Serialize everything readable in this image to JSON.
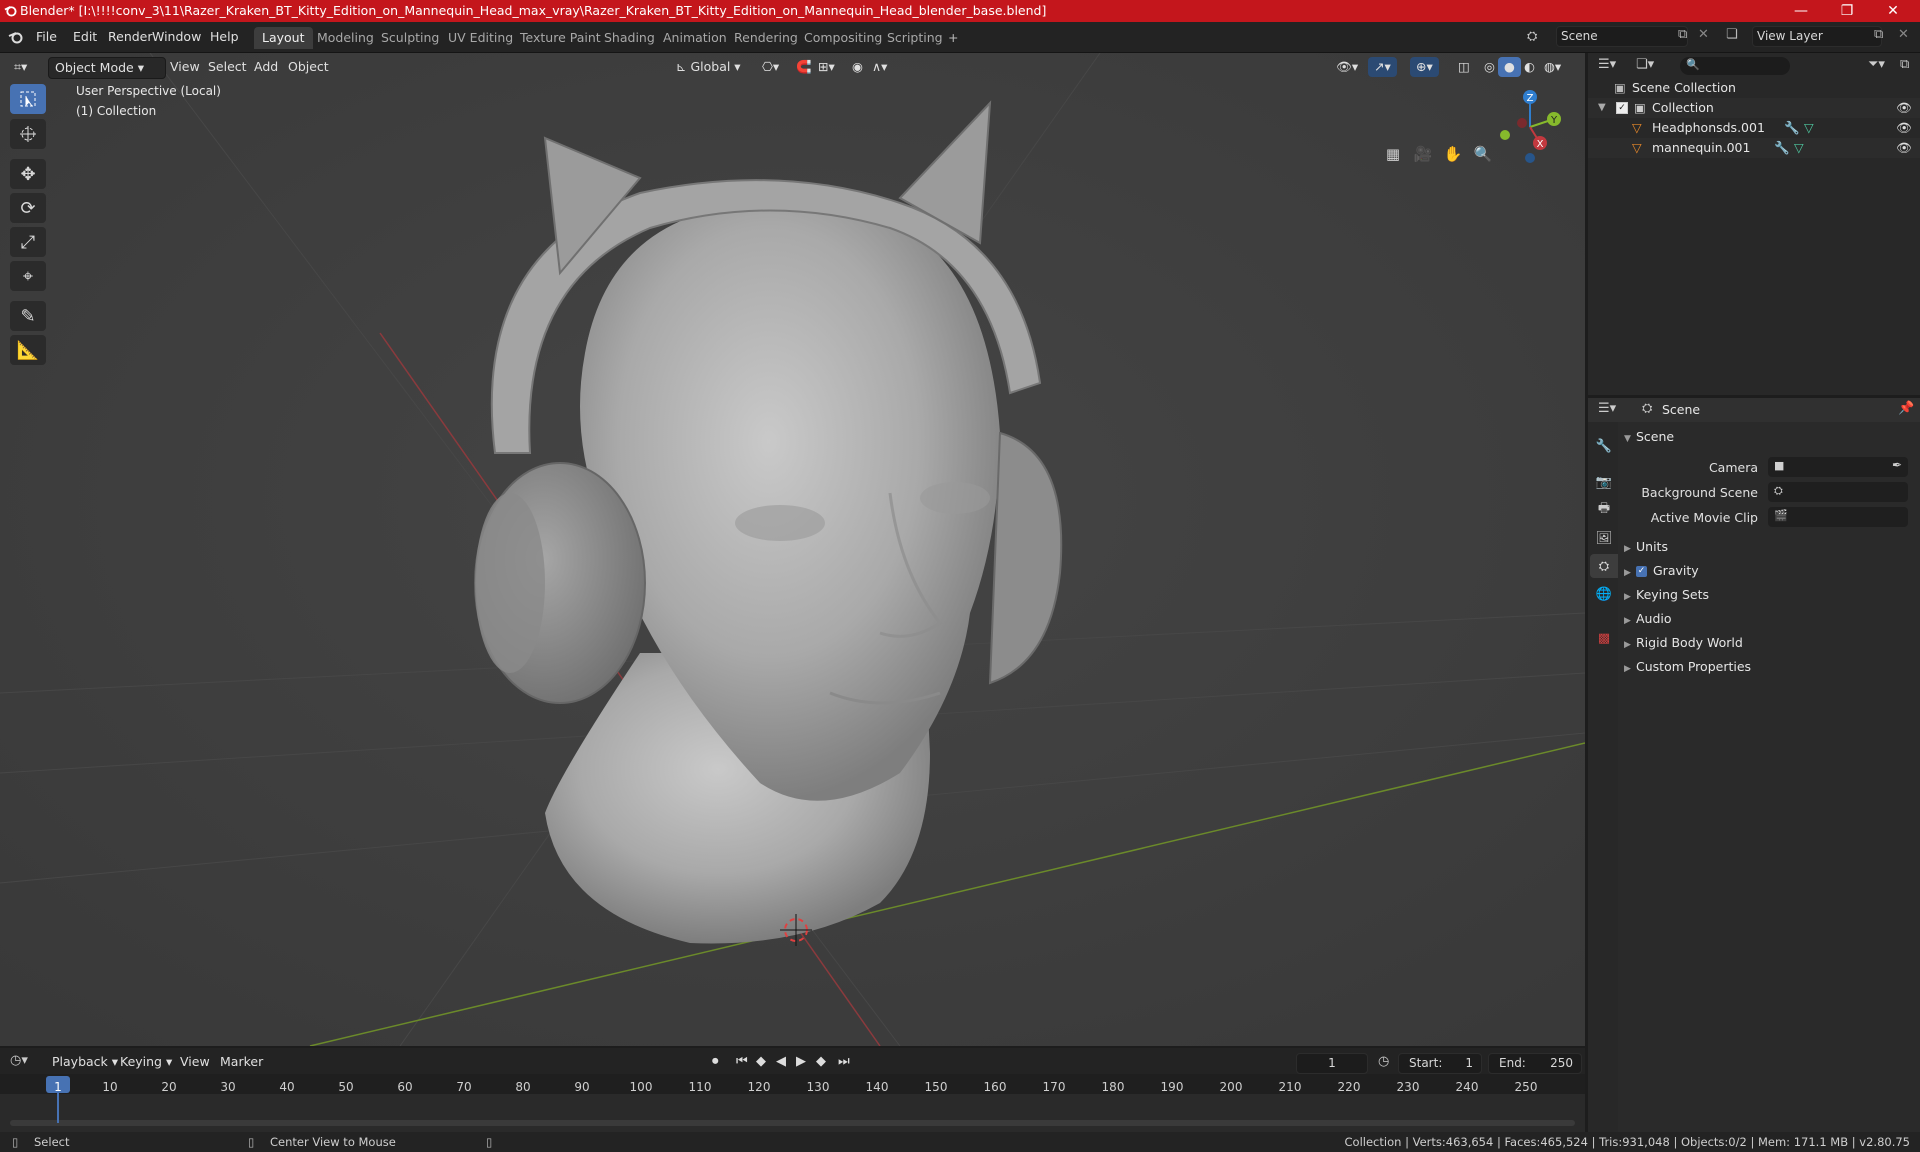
{
  "window": {
    "title": "Blender* [I:\\!!!!conv_3\\11\\Razer_Kraken_BT_Kitty_Edition_on_Mannequin_Head_max_vray\\Razer_Kraken_BT_Kitty_Edition_on_Mannequin_Head_blender_base.blend]",
    "minimize": "—",
    "restore": "❐",
    "close": "✕"
  },
  "menu": [
    "File",
    "Edit",
    "Render",
    "Window",
    "Help"
  ],
  "workspaces": [
    "Layout",
    "Modeling",
    "Sculpting",
    "UV Editing",
    "Texture Paint",
    "Shading",
    "Animation",
    "Rendering",
    "Compositing",
    "Scripting"
  ],
  "workspace_add": "+",
  "scene_selector": {
    "value": "Scene"
  },
  "view_layer_selector": {
    "value": "View Layer"
  },
  "viewport": {
    "mode": "Object Mode",
    "menus": [
      "View",
      "Select",
      "Add",
      "Object"
    ],
    "orientation": "Global",
    "overlay_text": [
      "User Perspective (Local)",
      "(1) Collection"
    ],
    "gizmo_axes": {
      "z": "Z",
      "y": "Y",
      "x": "X"
    }
  },
  "outliner": {
    "search_placeholder": "",
    "root": "Scene Collection",
    "collection": "Collection",
    "objects": [
      "Headphonsds.001",
      "mannequin.001"
    ]
  },
  "properties": {
    "header": "Scene",
    "panel_title": "Scene",
    "fields": [
      {
        "label": "Camera",
        "value": ""
      },
      {
        "label": "Background Scene",
        "value": ""
      },
      {
        "label": "Active Movie Clip",
        "value": ""
      }
    ],
    "sections": [
      "Units",
      "Gravity",
      "Keying Sets",
      "Audio",
      "Rigid Body World",
      "Custom Properties"
    ],
    "gravity_checked": true
  },
  "timeline": {
    "menus": [
      "Playback",
      "Keying",
      "View",
      "Marker"
    ],
    "current_frame": "1",
    "start_label": "Start:",
    "start": "1",
    "end_label": "End:",
    "end": "250",
    "ticks": [
      "1",
      "10",
      "20",
      "30",
      "40",
      "50",
      "60",
      "70",
      "80",
      "90",
      "100",
      "110",
      "120",
      "130",
      "140",
      "150",
      "160",
      "170",
      "180",
      "190",
      "200",
      "210",
      "220",
      "230",
      "240",
      "250"
    ]
  },
  "statusbar": {
    "left_action": "Select",
    "middle_action": "Center View to Mouse",
    "stats": "Collection | Verts:463,654 | Faces:465,524 | Tris:931,048 | Objects:0/2 | Mem: 171.1 MB | v2.80.75"
  },
  "colors": {
    "titlebar": "#c4161c",
    "accent": "#4772b3",
    "viewport_bg": "#3d3d3d",
    "x_axis": "#c2393f",
    "y_axis": "#86b92c",
    "z_axis": "#2f7ecf"
  }
}
